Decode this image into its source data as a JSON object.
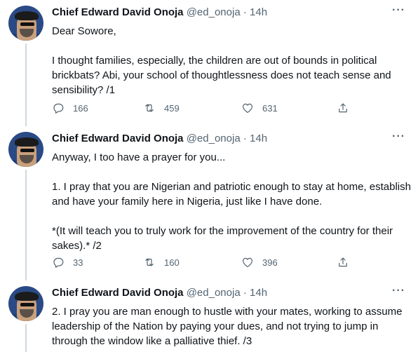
{
  "tweets": [
    {
      "author_name": "Chief Edward David Onoja",
      "handle": "@ed_onoja",
      "time": "14h",
      "paragraphs": [
        "Dear Sowore,",
        "I thought families, especially, the children are out of bounds in political brickbats? Abi, your school of thoughtlessness does not teach sense and sensibility?  /1"
      ],
      "replies": "166",
      "retweets": "459",
      "likes": "631"
    },
    {
      "author_name": "Chief Edward David Onoja",
      "handle": "@ed_onoja",
      "time": "14h",
      "paragraphs": [
        "Anyway, I too have a prayer for you...",
        "1. I pray that you are Nigerian and patriotic enough to stay at home, establish and have your family  here in Nigeria, just like I have done.",
        "*(It will teach you to truly work for the improvement of the country for their sakes).*  /2"
      ],
      "replies": "33",
      "retweets": "160",
      "likes": "396"
    },
    {
      "author_name": "Chief Edward David Onoja",
      "handle": "@ed_onoja",
      "time": "14h",
      "paragraphs": [
        "2. I pray you are man enough to hustle with your mates, working to assume leadership of the Nation by paying your dues, and not trying to jump in through the window like a palliative thief.  /3"
      ]
    }
  ],
  "icons": {
    "reply": "reply-icon",
    "retweet": "retweet-icon",
    "like": "heart-icon",
    "share": "share-icon",
    "more": "more-options-icon"
  }
}
